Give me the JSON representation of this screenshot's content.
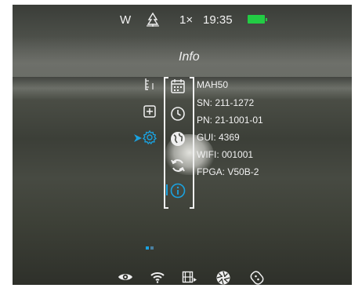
{
  "statusbar": {
    "mode": "W",
    "scene_icon": "forest-mode-icon",
    "zoom": "1×",
    "time": "19:35",
    "battery_icon": "battery-icon",
    "battery_color": "#22cc44"
  },
  "menu": {
    "title": "Info",
    "left_icons": [
      "ruler-icon",
      "plus-box-icon",
      "gear-icon"
    ],
    "selector_icon": "selector-arrow-icon",
    "mid_icons": [
      "calendar-icon",
      "clock-icon",
      "globe-icon",
      "refresh-icon",
      "info-icon"
    ],
    "accent_color": "#1aa2e0"
  },
  "info": {
    "model": "MAH50",
    "sn": "SN: 211-1272",
    "pn": "PN: 21-1001-01",
    "gui": "GUI: 4369",
    "wifi": "WIFI: 001001",
    "fpga": "FPGA: V50B-2"
  },
  "bottombar": {
    "icons": [
      "eye-icon",
      "wifi-icon",
      "video-recording-icon",
      "aperture-icon",
      "stabilizer-icon"
    ]
  }
}
